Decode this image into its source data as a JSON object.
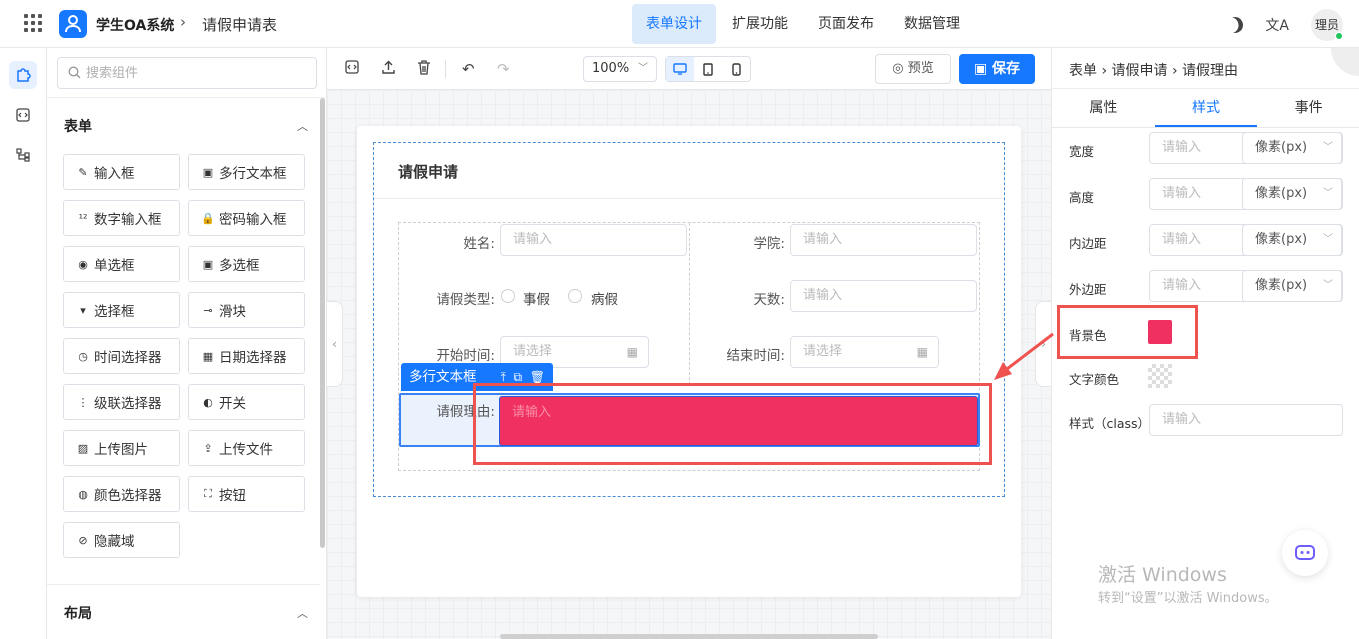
{
  "header": {
    "app_title": "学生OA系统",
    "crumb_separator": "›",
    "page_title": "请假申请表",
    "tabs": [
      {
        "label": "表单设计",
        "active": true
      },
      {
        "label": "扩展功能",
        "active": false
      },
      {
        "label": "页面发布",
        "active": false
      },
      {
        "label": "数据管理",
        "active": false
      }
    ],
    "user_label": "理员",
    "translate_glyph": "文A"
  },
  "components": {
    "search_placeholder": "搜索组件",
    "section_form": "表单",
    "section_layout": "布局",
    "items": [
      {
        "label": "输入框",
        "icon": "pencil-icon",
        "glyph": "✎"
      },
      {
        "label": "多行文本框",
        "icon": "textarea-icon",
        "glyph": "▣"
      },
      {
        "label": "数字输入框",
        "icon": "number-input-icon",
        "glyph": "¹²"
      },
      {
        "label": "密码输入框",
        "icon": "lock-icon",
        "glyph": "🔒"
      },
      {
        "label": "单选框",
        "icon": "radio-icon",
        "glyph": "◉"
      },
      {
        "label": "多选框",
        "icon": "checkbox-icon",
        "glyph": "▣"
      },
      {
        "label": "选择框",
        "icon": "select-icon",
        "glyph": "▾"
      },
      {
        "label": "滑块",
        "icon": "slider-icon",
        "glyph": "⊸"
      },
      {
        "label": "时间选择器",
        "icon": "clock-icon",
        "glyph": "◷"
      },
      {
        "label": "日期选择器",
        "icon": "calendar-icon",
        "glyph": "▦"
      },
      {
        "label": "级联选择器",
        "icon": "cascader-icon",
        "glyph": "⋮"
      },
      {
        "label": "开关",
        "icon": "switch-icon",
        "glyph": "◐"
      },
      {
        "label": "上传图片",
        "icon": "image-icon",
        "glyph": "▨"
      },
      {
        "label": "上传文件",
        "icon": "upload-icon",
        "glyph": "⇪"
      },
      {
        "label": "颜色选择器",
        "icon": "palette-icon",
        "glyph": "◍"
      },
      {
        "label": "按钮",
        "icon": "button-icon",
        "glyph": "⛶"
      },
      {
        "label": "隐藏域",
        "icon": "eye-off-icon",
        "glyph": "⊘"
      }
    ]
  },
  "toolbar": {
    "zoom": "100%",
    "preview_label": "预览",
    "save_label": "保存"
  },
  "form": {
    "title": "请假申请",
    "fields": {
      "name_label": "姓名:",
      "name_placeholder": "请输入",
      "college_label": "学院:",
      "college_placeholder": "请输入",
      "leave_type_label": "请假类型:",
      "leave_type_options": [
        "事假",
        "病假"
      ],
      "days_label": "天数:",
      "days_placeholder": "请输入",
      "start_label": "开始时间:",
      "start_placeholder": "请选择",
      "end_label": "结束时间:",
      "end_placeholder": "请选择",
      "reason_label": "请假理由:",
      "reason_placeholder": "请输入"
    },
    "selected_tag": "多行文本框",
    "selected_bg_color": "#f03060"
  },
  "properties": {
    "breadcrumb": "表单 › 请假申请 › 请假理由",
    "tabs": [
      {
        "label": "属性",
        "active": false
      },
      {
        "label": "样式",
        "active": true
      },
      {
        "label": "事件",
        "active": false
      }
    ],
    "rows": [
      {
        "label": "宽度",
        "placeholder": "请输入",
        "unit": "像素(px)"
      },
      {
        "label": "高度",
        "placeholder": "请输入",
        "unit": "像素(px)"
      },
      {
        "label": "内边距",
        "placeholder": "请输入",
        "unit": "像素(px)"
      },
      {
        "label": "外边距",
        "placeholder": "请输入",
        "unit": "像素(px)"
      }
    ],
    "bg_color_label": "背景色",
    "bg_color_value": "#f03060",
    "text_color_label": "文字颜色",
    "class_label": "样式（class）",
    "class_placeholder": "请输入"
  },
  "watermark": {
    "line1": "激活 Windows",
    "line2": "转到“设置”以激活 Windows。"
  },
  "colors": {
    "accent": "#1677ff",
    "annotation": "#ef5350"
  }
}
